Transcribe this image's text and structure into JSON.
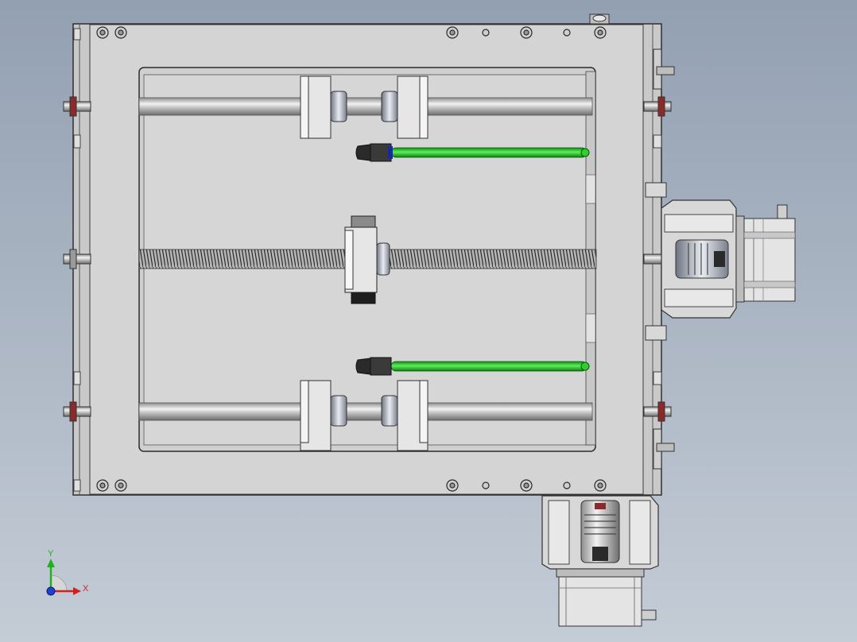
{
  "viewport": {
    "background_top": "#93a0b2",
    "background_bottom": "#c4ccd6"
  },
  "colors": {
    "plate": "#d2d2d2",
    "plate_edge": "#2f2f2f",
    "rod": "#bdbdbd",
    "green_tube": "#2fcf2f",
    "bolt_red": "#8a2a2a",
    "dark_block": "#3a3a3a"
  },
  "triad": {
    "x_label": "X",
    "y_label": "Y",
    "x_color": "#d02020",
    "y_color": "#20b020",
    "z_color": "#2040d0"
  },
  "icons": [
    "coordinate-triad-icon",
    "stepper-motor-icon",
    "shaft-coupling-icon",
    "lead-screw-icon",
    "linear-rod-icon"
  ]
}
